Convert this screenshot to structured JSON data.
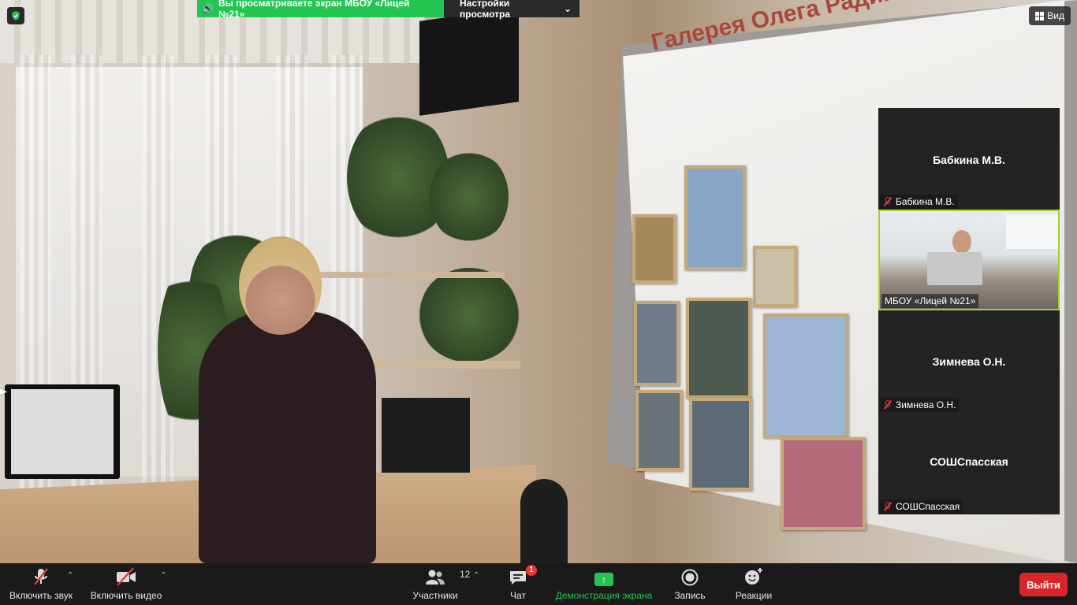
{
  "share_banner": {
    "viewing_text": "Вы просматриваете экран МБОУ «Лицей №21»",
    "view_options": "Настройки просмотра"
  },
  "view_button": {
    "label": "Вид"
  },
  "shared_screen": {
    "slide_title": "Галерея Олега Радина «АЯ»"
  },
  "participants": [
    {
      "display_name": "Бабкина М.В.",
      "label": "Бабкина М.В.",
      "muted": true,
      "video": false
    },
    {
      "display_name": "",
      "label": "МБОУ «Лицей №21»",
      "muted": false,
      "video": true,
      "active_speaker": true
    },
    {
      "display_name": "Зимнева О.Н.",
      "label": "Зимнева О.Н.",
      "muted": true,
      "video": false
    },
    {
      "display_name": "СОШСпасская",
      "label": "СОШСпасская",
      "muted": true,
      "video": false
    }
  ],
  "toolbar": {
    "unmute_label": "Включить звук",
    "start_video_label": "Включить видео",
    "participants_label": "Участники",
    "participants_count": "12",
    "chat_label": "Чат",
    "chat_badge": "1",
    "share_screen_label": "Демонстрация экрана",
    "record_label": "Запись",
    "reactions_label": "Реакции",
    "leave_label": "Выйти"
  },
  "colors": {
    "share_green": "#23c552",
    "leave_red": "#d9262b",
    "active_speaker_border": "#a4d02d",
    "mute_red": "#e53935"
  }
}
